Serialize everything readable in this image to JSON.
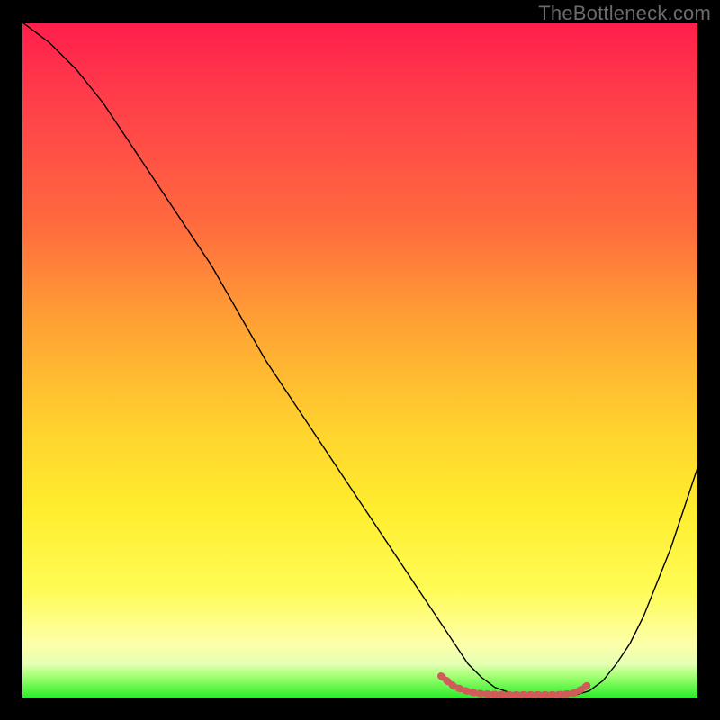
{
  "watermark": "TheBottleneck.com",
  "chart_data": {
    "type": "line",
    "title": "",
    "xlabel": "",
    "ylabel": "",
    "xlim": [
      0,
      100
    ],
    "ylim": [
      0,
      100
    ],
    "series": [
      {
        "name": "bottleneck-curve",
        "x": [
          0,
          4,
          8,
          12,
          16,
          20,
          24,
          28,
          32,
          36,
          40,
          44,
          48,
          52,
          56,
          60,
          62,
          64,
          66,
          68,
          70,
          72,
          74,
          76,
          78,
          80,
          82,
          84,
          86,
          88,
          90,
          92,
          94,
          96,
          98,
          100
        ],
        "y": [
          100,
          97,
          93,
          88,
          82,
          76,
          70,
          64,
          57,
          50,
          44,
          38,
          32,
          26,
          20,
          14,
          11,
          8,
          5,
          3,
          1.5,
          0.8,
          0.4,
          0.3,
          0.3,
          0.3,
          0.4,
          1.0,
          2.5,
          5,
          8,
          12,
          17,
          22,
          28,
          34
        ],
        "color": "#000000",
        "width": 1.4
      },
      {
        "name": "optimal-range-marker",
        "x": [
          62,
          64,
          66,
          68,
          70,
          72,
          74,
          76,
          78,
          80,
          82,
          84
        ],
        "y": [
          3.2,
          1.6,
          0.9,
          0.55,
          0.45,
          0.4,
          0.4,
          0.4,
          0.4,
          0.45,
          0.7,
          2.0
        ],
        "color": "#cf5b5b",
        "width": 8,
        "dash": "2 6",
        "linecap": "round"
      }
    ],
    "grid": false,
    "legend": false
  }
}
